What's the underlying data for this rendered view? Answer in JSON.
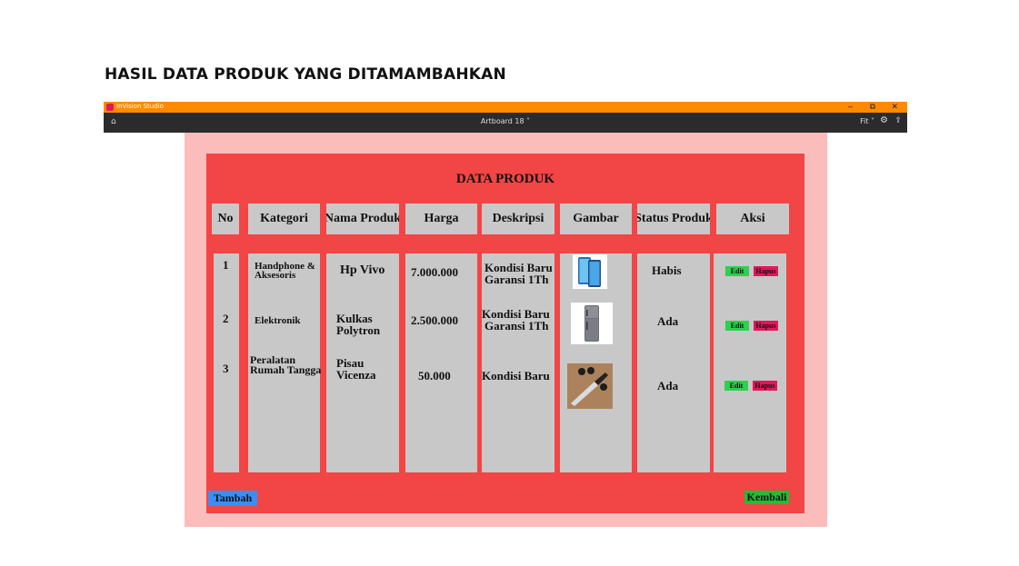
{
  "heading": "HASIL DATA PRODUK YANG DITAMAMBAHKAN",
  "window": {
    "app_name": "InVision Studio",
    "artboard": "Artboard 18 ˅",
    "zoom": "Fit ˅",
    "controls": {
      "minimize": "–",
      "maximize": "⧉",
      "close": "✕"
    }
  },
  "panel": {
    "title": "DATA PRODUK",
    "headers": {
      "no": "No",
      "kategori": "Kategori",
      "nama": "Nama Produk",
      "harga": "Harga",
      "deskripsi": "Deskripsi",
      "gambar": "Gambar",
      "status": "Status Produk",
      "aksi": "Aksi"
    },
    "rows": [
      {
        "no": "1",
        "kategori_1": "Handphone &",
        "kategori_2": "Aksesoris",
        "nama_1": "Hp Vivo",
        "nama_2": "",
        "harga": "7.000.000",
        "deskripsi_1": "Kondisi Baru",
        "deskripsi_2": "Garansi 1Th",
        "gambar": "smartphone-image",
        "status": "Habis",
        "edit": "Edit",
        "hapus": "Hapus"
      },
      {
        "no": "2",
        "kategori_1": "Elektronik",
        "kategori_2": "",
        "nama_1": "Kulkas",
        "nama_2": "Polytron",
        "harga": "2.500.000",
        "deskripsi_1": "Kondisi Baru",
        "deskripsi_2": "Garansi 1Th",
        "gambar": "refrigerator-image",
        "status": "Ada",
        "edit": "Edit",
        "hapus": "Hapus"
      },
      {
        "no": "3",
        "kategori_1": "Peralatan",
        "kategori_2": "Rumah Tangga",
        "nama_1": "Pisau",
        "nama_2": "Vicenza",
        "harga": "50.000",
        "deskripsi_1": "Kondisi Baru",
        "deskripsi_2": "",
        "gambar": "knife-image",
        "status": "Ada",
        "edit": "Edit",
        "hapus": "Hapus"
      }
    ],
    "tambah": "Tambah",
    "kembali": "Kembali"
  },
  "colors": {
    "panel": "#f24545",
    "canvas": "#fbbcbc",
    "cell": "#c8c8c8",
    "edit": "#2bd14f",
    "hapus": "#e2175a",
    "tambah": "#3a8ef7",
    "kembali": "#22bd34",
    "titlebar": "#ff8a00"
  }
}
